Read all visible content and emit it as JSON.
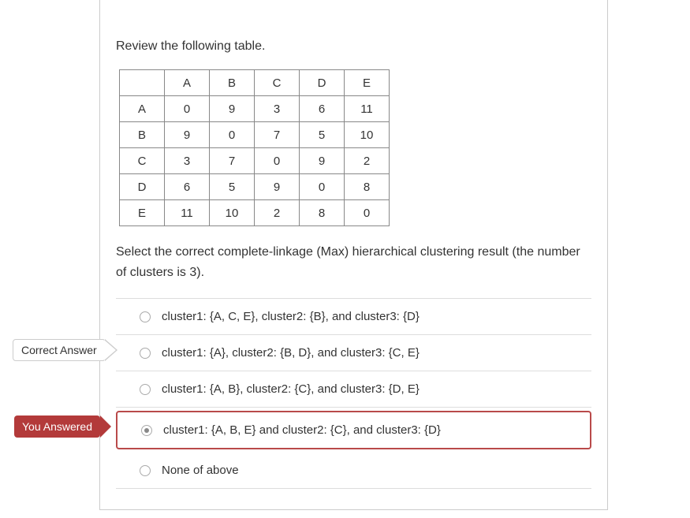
{
  "question": {
    "review_text": "Review the following table.",
    "prompt": "Select the correct complete-linkage (Max) hierarchical clustering result (the number of clusters is 3).",
    "table": {
      "headers": [
        "",
        "A",
        "B",
        "C",
        "D",
        "E"
      ],
      "rows": [
        {
          "label": "A",
          "cells": [
            "0",
            "9",
            "3",
            "6",
            "11"
          ]
        },
        {
          "label": "B",
          "cells": [
            "9",
            "0",
            "7",
            "5",
            "10"
          ]
        },
        {
          "label": "C",
          "cells": [
            "3",
            "7",
            "0",
            "9",
            "2"
          ]
        },
        {
          "label": "D",
          "cells": [
            "6",
            "5",
            "9",
            "0",
            "8"
          ]
        },
        {
          "label": "E",
          "cells": [
            "11",
            "10",
            "2",
            "8",
            "0"
          ]
        }
      ]
    },
    "options": [
      {
        "text": "cluster1: {A, C, E}, cluster2: {B}, and cluster3: {D}",
        "selected": false
      },
      {
        "text": "cluster1: {A}, cluster2: {B, D}, and cluster3: {C, E}",
        "selected": false
      },
      {
        "text": "cluster1: {A, B}, cluster2: {C}, and cluster3: {D, E}",
        "selected": false
      },
      {
        "text": "cluster1: {A, B, E} and cluster2: {C}, and cluster3: {D}",
        "selected": true
      },
      {
        "text": "None of above",
        "selected": false
      }
    ]
  },
  "badges": {
    "correct": "Correct Answer",
    "answered": "You Answered"
  }
}
